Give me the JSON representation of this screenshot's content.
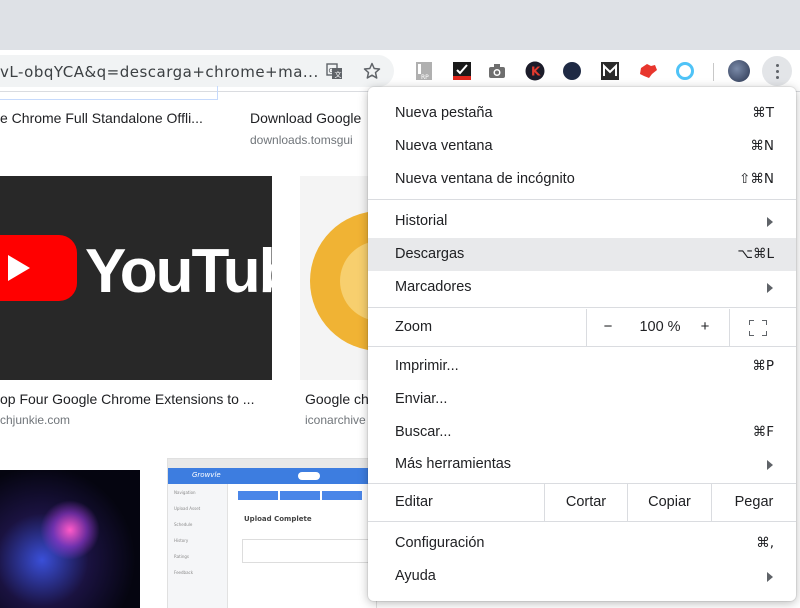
{
  "browser": {
    "url_text": "vL-obqYCA&q=descarga+chrome+ma...",
    "extensions": [
      "rp-extension-icon",
      "checklist-extension-icon",
      "camera-extension-icon",
      "k-extension-icon",
      "vpn-extension-icon",
      "m-extension-icon",
      "puzzle-extension-icon",
      "ring-extension-icon"
    ]
  },
  "results": {
    "row1": [
      {
        "title": "e Chrome Full Standalone Offli...",
        "source": ""
      },
      {
        "title": "Download Google",
        "source": "downloads.tomsgui"
      }
    ],
    "row2": [
      {
        "title": "op Four Google Chrome Extensions to ...",
        "source": "chjunkie.com"
      },
      {
        "title": "Google ch",
        "source": "iconarchive"
      }
    ],
    "youtube_word": "YouTube",
    "grovvle": {
      "brand": "Growvle",
      "heading": "Upload Complete",
      "sidebar": [
        "Navigation",
        "Upload Asset",
        "Schedule",
        "History",
        "Ratings",
        "Feedback"
      ]
    }
  },
  "menu": {
    "items": [
      {
        "label": "Nueva pestaña",
        "shortcut": "⌘T"
      },
      {
        "label": "Nueva ventana",
        "shortcut": "⌘N"
      },
      {
        "label": "Nueva ventana de incógnito",
        "shortcut": "⇧⌘N"
      },
      {
        "label": "Historial",
        "submenu": true
      },
      {
        "label": "Descargas",
        "shortcut": "⌥⌘L",
        "highlighted": true
      },
      {
        "label": "Marcadores",
        "submenu": true
      },
      {
        "label": "Imprimir...",
        "shortcut": "⌘P"
      },
      {
        "label": "Enviar..."
      },
      {
        "label": "Buscar...",
        "shortcut": "⌘F"
      },
      {
        "label": "Más herramientas",
        "submenu": true
      },
      {
        "label": "Configuración",
        "shortcut": "⌘,"
      },
      {
        "label": "Ayuda",
        "submenu": true
      }
    ],
    "zoom": {
      "label": "Zoom",
      "minus": "−",
      "value": "100 %",
      "plus": "+"
    },
    "edit": {
      "label": "Editar",
      "cut": "Cortar",
      "copy": "Copiar",
      "paste": "Pegar"
    }
  },
  "colors": {
    "menu_highlight": "#e8e9eb",
    "youtube_red": "#ff0000",
    "chrome_yellow": "#f0b334"
  }
}
